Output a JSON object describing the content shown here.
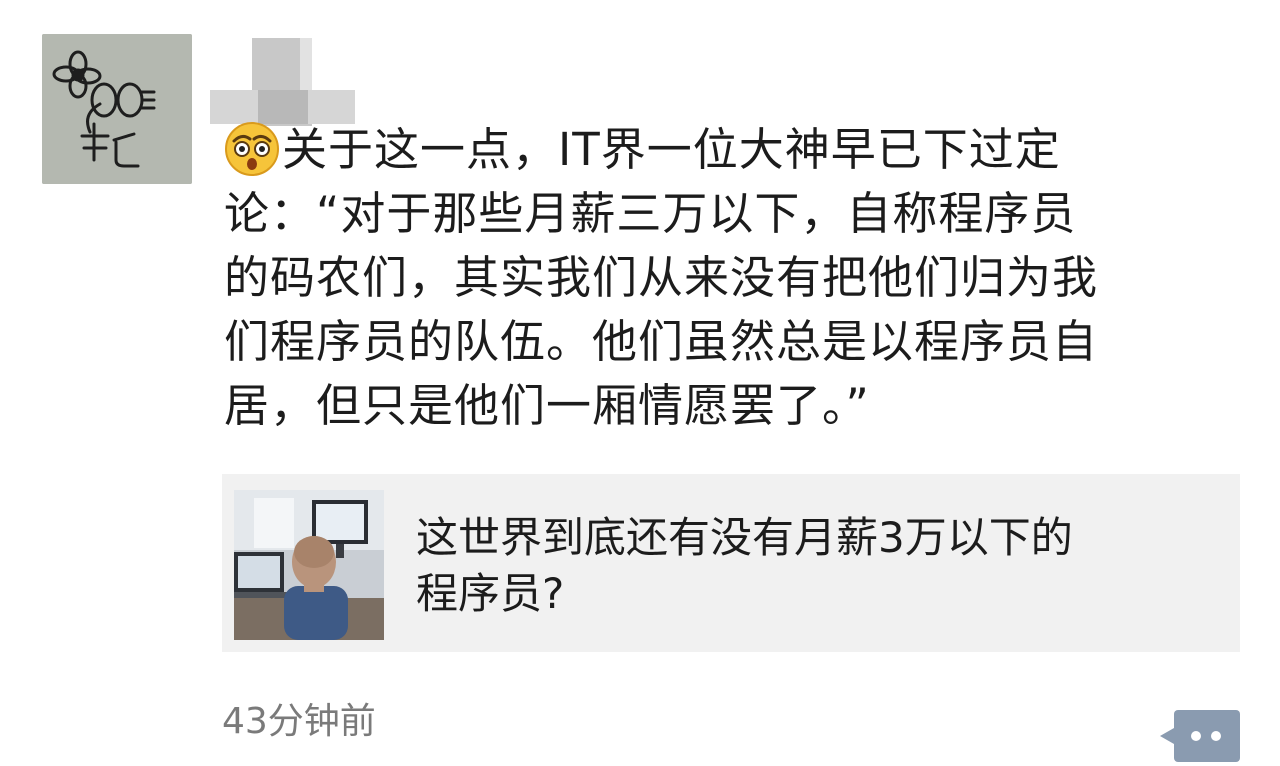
{
  "post": {
    "text_lines": [
      "关于这一点，IT界一位大神早已下过定",
      "论：“对于那些月薪三万以下，自称程序员",
      "的码农们，其实我们从来没有把他们归为我",
      "们程序员的队伍。他们虽然总是以程序员自",
      "居，但只是他们一厢情愿罢了。”"
    ],
    "emoji": "shocked-face-icon"
  },
  "link_card": {
    "title_lines": [
      "这世界到底还有没有月薪3万以下的",
      "程序员?"
    ]
  },
  "footer": {
    "timestamp": "43分钟前",
    "comment_icon": "comment-dots-icon"
  },
  "colors": {
    "link_card_bg": "#f1f1f1",
    "timestamp": "#7a7a7a",
    "comment_button": "#8a9bb0"
  }
}
